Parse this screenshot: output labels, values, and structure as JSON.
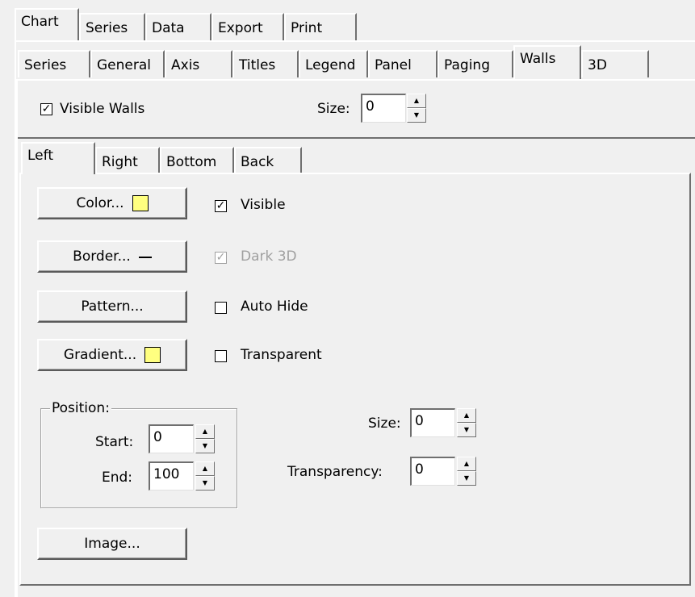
{
  "top_tabs": [
    "Chart",
    "Series",
    "Data",
    "Export",
    "Print"
  ],
  "chart_tabs": [
    "Series",
    "General",
    "Axis",
    "Titles",
    "Legend",
    "Panel",
    "Paging",
    "Walls",
    "3D"
  ],
  "walls": {
    "visible_walls_label": "Visible Walls",
    "visible_walls_checked": true,
    "size_label": "Size:",
    "size_value": "0"
  },
  "wall_tabs": [
    "Left",
    "Right",
    "Bottom",
    "Back"
  ],
  "buttons": {
    "color": "Color...",
    "border": "Border...",
    "pattern": "Pattern...",
    "gradient": "Gradient...",
    "image": "Image..."
  },
  "options": {
    "visible": {
      "label": "Visible",
      "checked": true,
      "enabled": true
    },
    "dark3d": {
      "label": "Dark 3D",
      "checked": true,
      "enabled": false
    },
    "autohide": {
      "label": "Auto Hide",
      "checked": false,
      "enabled": true
    },
    "transparent": {
      "label": "Transparent",
      "checked": false,
      "enabled": true
    }
  },
  "position": {
    "group_label": "Position:",
    "start_label": "Start:",
    "start_value": "0",
    "end_label": "End:",
    "end_value": "100"
  },
  "wall_size_label": "Size:",
  "wall_size_value": "0",
  "transparency_label": "Transparency:",
  "transparency_value": "0",
  "colors": {
    "swatch": "#ffff80",
    "background": "#f0f0f0"
  }
}
